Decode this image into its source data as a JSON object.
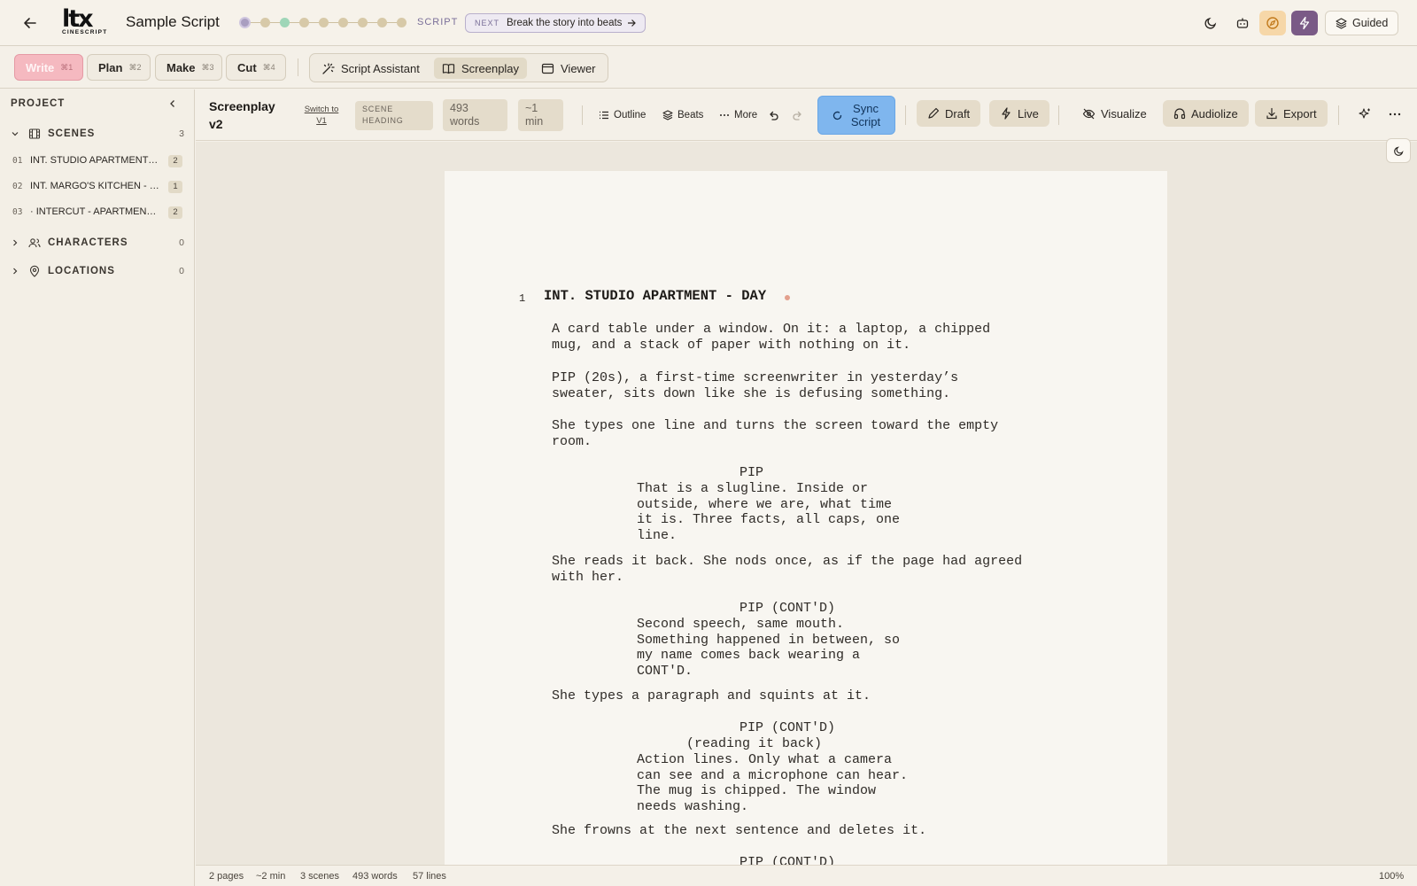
{
  "app": {
    "title": "Sample Script",
    "logo_text": "ltx",
    "logo_sub": "CINESCRIPT",
    "step_label": "SCRIPT",
    "next": {
      "key": "NEXT",
      "text": "Break the story into beats"
    },
    "guided_label": "Guided",
    "progress_steps": [
      "current",
      "todo",
      "done",
      "todo",
      "todo",
      "todo",
      "todo",
      "todo",
      "todo"
    ]
  },
  "modes": [
    {
      "label": "Write",
      "kbd": "⌘1",
      "active": true
    },
    {
      "label": "Plan",
      "kbd": "⌘2"
    },
    {
      "label": "Make",
      "kbd": "⌘3"
    },
    {
      "label": "Cut",
      "kbd": "⌘4"
    }
  ],
  "views": [
    {
      "label": "Script Assistant",
      "icon": "wand-icon"
    },
    {
      "label": "Screenplay",
      "icon": "book-icon",
      "active": true
    },
    {
      "label": "Viewer",
      "icon": "window-icon"
    }
  ],
  "sidebar": {
    "heading": "PROJECT",
    "scenes": {
      "label": "SCENES",
      "count": "3",
      "items": [
        {
          "num": "01",
          "name": "INT. STUDIO APARTMENT - DAY",
          "count": "2"
        },
        {
          "num": "02",
          "name": "INT. MARGO'S KITCHEN - NIGHT",
          "count": "1"
        },
        {
          "num": "03",
          "name": "· INTERCUT - APARTMENT / KITCHEN",
          "count": "2"
        }
      ]
    },
    "characters": {
      "label": "CHARACTERS",
      "count": "0"
    },
    "locations": {
      "label": "LOCATIONS",
      "count": "0"
    }
  },
  "editor": {
    "title": "Screenplay v2",
    "switch_label": "Switch to V1",
    "element_type": "SCENE HEADING",
    "word_count": "493 words",
    "duration": "~1 min",
    "outline_label": "Outline",
    "beats_label": "Beats",
    "more_label": "More",
    "sync_label": "Sync Script",
    "draft_label": "Draft",
    "live_label": "Live",
    "visualize_label": "Visualize",
    "audiolize_label": "Audiolize",
    "export_label": "Export"
  },
  "script": {
    "scene_number": "1",
    "slugline": "INT. STUDIO APARTMENT - DAY",
    "action_1": "A card table under a window. On it: a laptop, a chipped\nmug, and a stack of paper with nothing on it.",
    "action_2": "PIP (20s), a first-time screenwriter in yesterday’s\nsweater, sits down like she is defusing something.",
    "action_3": "She types one line and turns the screen toward the empty\nroom.",
    "char_1": "PIP",
    "dialogue_1": "That is a slugline. Inside or\noutside, where we are, what time\nit is. Three facts, all caps, one\nline.",
    "action_4": "She reads it back. She nods once, as if the page had agreed\nwith her.",
    "char_2": "PIP (CONT'D)",
    "dialogue_2": "Second speech, same mouth.\nSomething happened in between, so\nmy name comes back wearing a\nCONT'D.",
    "action_5": "She types a paragraph and squints at it.",
    "char_3": "PIP (CONT'D)",
    "paren_3": "(reading it back)",
    "dialogue_3": "Action lines. Only what a camera\ncan see and a microphone can hear.\nThe mug is chipped. The window\nneeds washing.",
    "action_6": "She frowns at the next sentence and deletes it.",
    "char_4": "PIP (CONT'D)"
  },
  "status": {
    "pages": "2 pages",
    "minutes": "~2 min",
    "scenes": "3 scenes",
    "words": "493 words",
    "lines": "57 lines",
    "zoom": "100%"
  },
  "colors": {
    "accent_write": "#f5b9c0",
    "sync_blue": "#7fb6ee",
    "bolt_purple": "#7a5a86",
    "compass_orange": "#f6d7a8"
  }
}
